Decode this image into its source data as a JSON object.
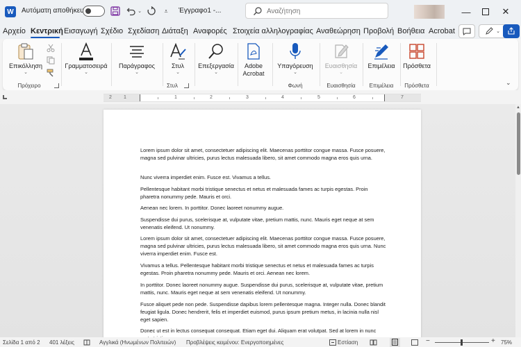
{
  "titlebar": {
    "app_logo": "W",
    "autosave_label": "Αυτόματη αποθήκευση",
    "doc_title": "Έγγραφο1  -...",
    "search_placeholder": "Αναζήτηση",
    "icons": [
      "save-icon",
      "undo-icon",
      "redo-icon",
      "customize-icon",
      "search-icon",
      "minimize-icon",
      "maximize-icon",
      "close-icon"
    ]
  },
  "menu": {
    "items": [
      "Αρχείο",
      "Κεντρική",
      "Εισαγωγή",
      "Σχέδιο",
      "Σχεδίαση",
      "Διάταξη",
      "Αναφορές",
      "Στοιχεία αλληλογραφίας",
      "Αναθεώρηση",
      "Προβολή",
      "Βοήθεια",
      "Acrobat"
    ],
    "active": "Κεντρική"
  },
  "ribbon": {
    "paste": "Επικόλληση",
    "clipboard_group": "Πρόχειρο",
    "font": "Γραμματοσειρά",
    "paragraph": "Παράγραφος",
    "styles": "Στυλ",
    "styles_group": "Στυλ",
    "editing": "Επεξεργασία",
    "adobe_acrobat_1": "Adobe",
    "adobe_acrobat_2": "Acrobat",
    "dictate": "Υπαγόρευση",
    "voice_group": "Φωνή",
    "sensitivity": "Ευαισθησία",
    "sensitivity_group": "Ευαισθησία",
    "editor": "Επιμέλεια",
    "editor_group": "Επιμέλεια",
    "addins": "Πρόσθετα",
    "addins_group": "Πρόσθετα"
  },
  "ruler": {
    "numbers": [
      "2",
      "1",
      "1",
      "2",
      "3",
      "4",
      "5",
      "6",
      "7"
    ]
  },
  "document": {
    "paragraphs": [
      "Lorem ipsum dolor sit amet, consectetuer adipiscing elit. Maecenas porttitor congue massa. Fusce posuere, magna sed pulvinar ultricies, purus lectus malesuada libero, sit amet commodo magna eros quis urna.",
      "Nunc viverra imperdiet enim. Fusce est. Vivamus a tellus.",
      "Pellentesque habitant morbi tristique senectus et netus et malesuada fames ac turpis egestas. Proin pharetra nonummy pede. Mauris et orci.",
      "Aenean nec lorem. In porttitor. Donec laoreet nonummy augue.",
      "Suspendisse dui purus, scelerisque at, vulputate vitae, pretium mattis, nunc. Mauris eget neque at sem venenatis eleifend. Ut nonummy.",
      "Lorem ipsum dolor sit amet, consectetuer adipiscing elit. Maecenas porttitor congue massa. Fusce posuere, magna sed pulvinar ultricies, purus lectus malesuada libero, sit amet commodo magna eros quis urna. Nunc viverra imperdiet enim. Fusce est.",
      "Vivamus a tellus. Pellentesque habitant morbi tristique senectus et netus et malesuada fames ac turpis egestas. Proin pharetra nonummy pede. Mauris et orci. Aenean nec lorem.",
      "In porttitor. Donec laoreet nonummy augue. Suspendisse dui purus, scelerisque at, vulputate vitae, pretium mattis, nunc. Mauris eget neque at sem venenatis eleifend. Ut nonummy.",
      "Fusce aliquet pede non pede. Suspendisse dapibus lorem pellentesque magna. Integer nulla. Donec blandit feugiat ligula. Donec hendrerit, felis et imperdiet euismod, purus ipsum pretium metus, in lacinia nulla nisl eget sapien.",
      "Donec ut est in lectus consequat consequat. Etiam eget dui. Aliquam erat volutpat. Sed at lorem in nunc porta tristique."
    ]
  },
  "status": {
    "page": "Σελίδα 1 από 2",
    "words": "401 λέξεις",
    "language": "Αγγλικά (Ηνωμένων Πολιτειών)",
    "predictions": "Προβλέψεις κειμένου: Ενεργοποιημένες",
    "focus": "Εστίαση",
    "zoom": "75%",
    "zoom_minus": "−",
    "zoom_plus": "+"
  },
  "colors": {
    "accent": "#185abd",
    "ribbon_bg": "#fbfbfb",
    "title_bg": "#eef1f4"
  }
}
